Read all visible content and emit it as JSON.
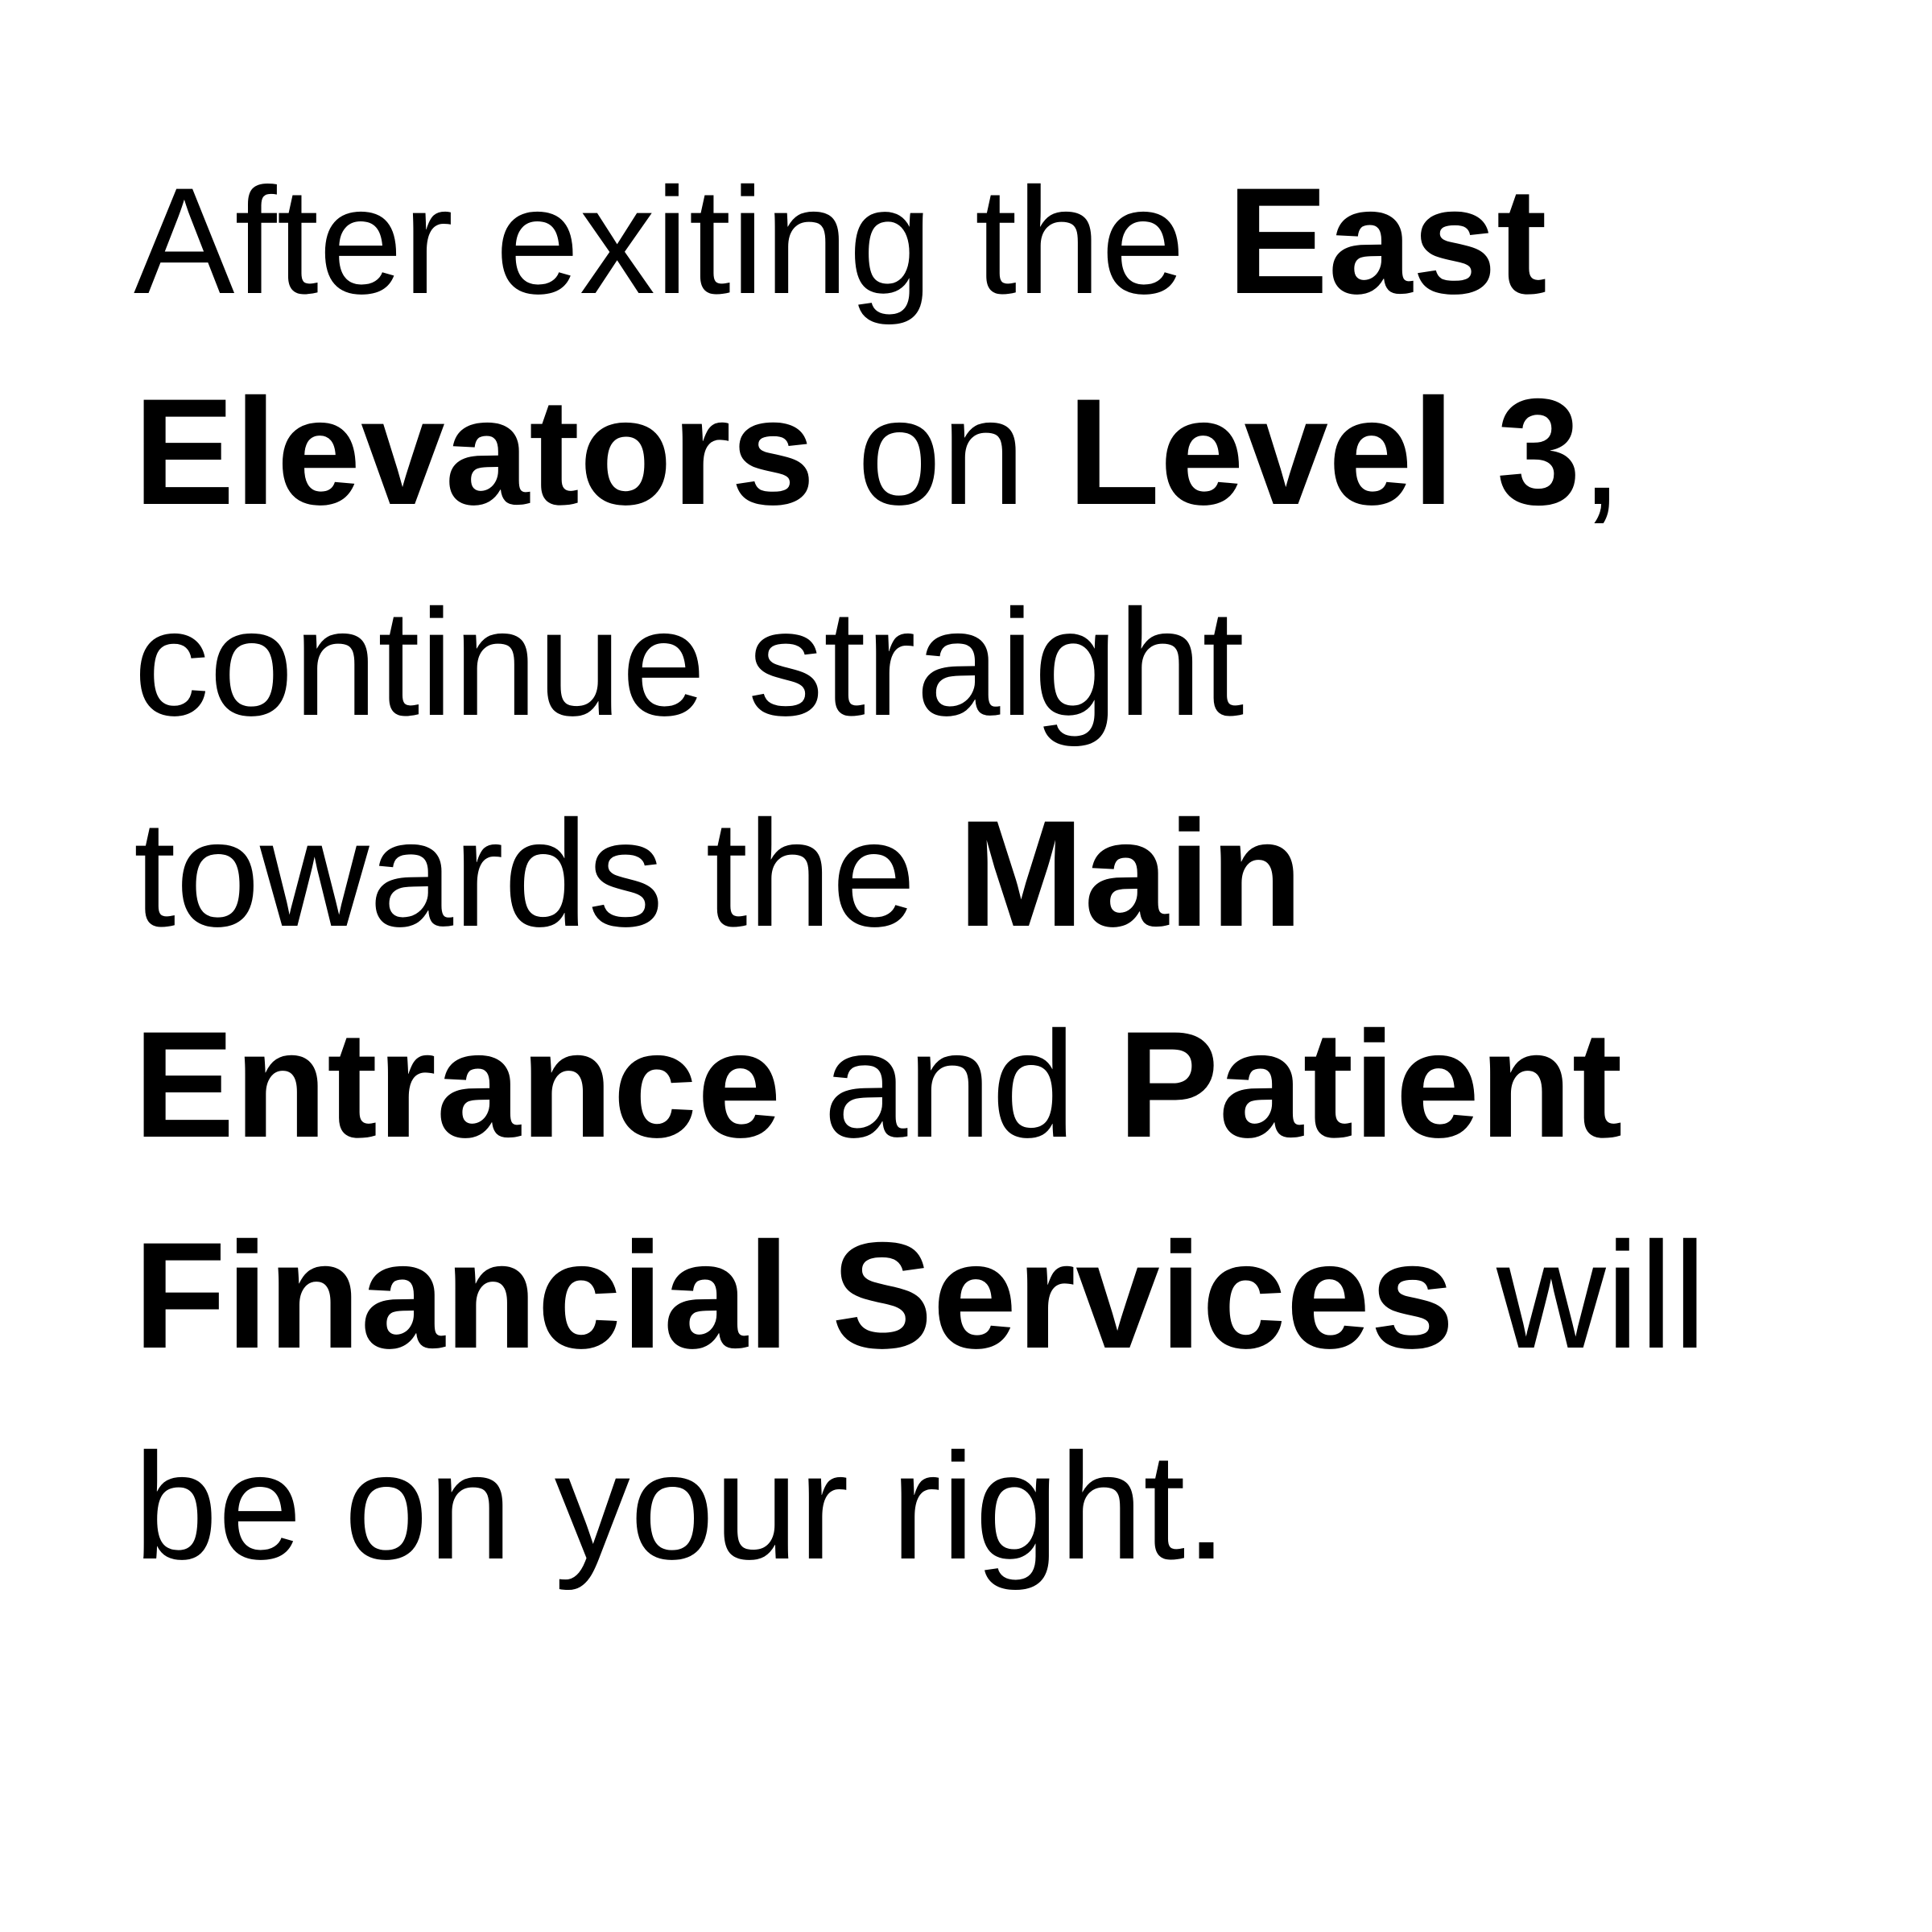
{
  "directions": {
    "lines": [
      [
        {
          "text": "After exiting the ",
          "bold": false
        },
        {
          "text": "East",
          "bold": true
        }
      ],
      [
        {
          "text": "Elevators",
          "bold": true
        },
        {
          "text": " on ",
          "bold": false
        },
        {
          "text": "Level 3",
          "bold": true
        },
        {
          "text": ",",
          "bold": false
        }
      ],
      [
        {
          "text": "continue straight",
          "bold": false
        }
      ],
      [
        {
          "text": "towards the ",
          "bold": false
        },
        {
          "text": "Main",
          "bold": true
        }
      ],
      [
        {
          "text": "Entrance",
          "bold": true
        },
        {
          "text": " and ",
          "bold": false
        },
        {
          "text": "Patient",
          "bold": true
        }
      ],
      [
        {
          "text": "Financial Services",
          "bold": true
        },
        {
          "text": " will",
          "bold": false
        }
      ],
      [
        {
          "text": "be on your right.",
          "bold": false
        }
      ]
    ]
  }
}
